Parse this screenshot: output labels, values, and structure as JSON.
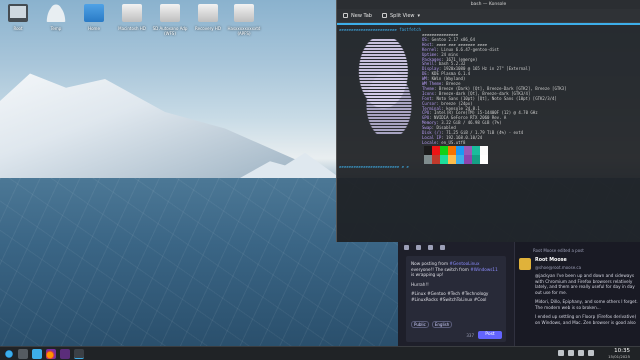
{
  "desktop_icons": [
    {
      "label": "Root",
      "icon": "monitor-icon"
    },
    {
      "label": "Temp",
      "icon": "user-folder-icon"
    },
    {
      "label": "Home",
      "icon": "home-folder-icon"
    },
    {
      "label": "Macintosh HD",
      "icon": "drive-icon"
    },
    {
      "label": "SD Autoxano Adp (WFS)",
      "icon": "drive-icon"
    },
    {
      "label": "Recovery HD",
      "icon": "drive-icon"
    },
    {
      "label": "Hasxxxxxxxxxtd (APFS)",
      "icon": "drive-icon"
    }
  ],
  "konsole": {
    "title": "bash — Konsole",
    "new_tab": "New Tab",
    "split_view": "Split View",
    "prompt_top": "▰▰▰▰▰▰▰▰▰▰▰▰▰▰▰▰▰▰▰▰▰▰▰▰ fastfetch",
    "prompt_bottom": "▰▰▰▰▰▰▰▰▰▰▰▰▰▰▰▰▰▰▰▰▰▰▰▰▰ ▰ ▰",
    "fastfetch": [
      {
        "k": "",
        "v": "▰▰▰▰▰▰▰▰▰▰▰▰▰▰▰"
      },
      {
        "k": "OS",
        "v": ": Gentoo 2.17 x86_64"
      },
      {
        "k": "Host",
        "v": ": ▰▰▰▰ ▰▰▰ ▰▰▰▰▰▰▰ ▰▰▰▰"
      },
      {
        "k": "Kernel",
        "v": ": Linux 6.6.47-gentoo-dist"
      },
      {
        "k": "Uptime",
        "v": ": 24 mins"
      },
      {
        "k": "Packages",
        "v": ": 1671 (emerge)"
      },
      {
        "k": "Shell",
        "v": ": bash 5.2.32"
      },
      {
        "k": "Display",
        "v": ": 1920x1080 @ 165 Hz in 27\" [External]"
      },
      {
        "k": "DE",
        "v": ": KDE Plasma 6.1.4"
      },
      {
        "k": "WM",
        "v": ": KWin (Wayland)"
      },
      {
        "k": "WM Theme",
        "v": ": Breeze"
      },
      {
        "k": "Theme",
        "v": ": Breeze (Dark) [Qt], Breeze-Dark [GTK2], Breeze [GTK3]"
      },
      {
        "k": "Icons",
        "v": ": Breeze-dark [Qt], Breeze-dark [GTK3/4]"
      },
      {
        "k": "Font",
        "v": ": Noto Sans (10pt) [Qt], Noto Sans (10pt) [GTK2/3/4]"
      },
      {
        "k": "Cursor",
        "v": ": breeze (24px)"
      },
      {
        "k": "Terminal",
        "v": ": konsole 24.8.1"
      },
      {
        "k": "CPU",
        "v": ": Intel(R) Core(TM) i5-14400F (12) @ 4.70 GHz"
      },
      {
        "k": "GPU",
        "v": ": NVIDIA GeForce RTX 2060 Rev. A"
      },
      {
        "k": "Memory",
        "v": ": 3.22 GiB / 46.98 GiB (7%)"
      },
      {
        "k": "Swap",
        "v": ": Disabled"
      },
      {
        "k": "Disk (/)",
        "v": ": 71.25 GiB / 1.79 TiB (4%) - ext4"
      },
      {
        "k": "Local IP",
        "v": ": 192.168.0.10/24"
      },
      {
        "k": "Locale",
        "v": ": en_US.utf8"
      }
    ],
    "palette": [
      "#1c1c1c",
      "#ed1515",
      "#11d116",
      "#f67400",
      "#1d99f3",
      "#9b59b6",
      "#1abc9c",
      "#fcfcfc",
      "#7f8c8d",
      "#c0392b",
      "#1cdc9a",
      "#fdbc4b",
      "#3daee9",
      "#8e44ad",
      "#16a085",
      "#ffffff"
    ]
  },
  "mastodon": {
    "compose_text_1": "Now posting from ",
    "compose_tag_1": "#GentooLinux",
    "compose_text_2": " everyone!! The switch from ",
    "compose_tag_2": "#Windows11",
    "compose_text_3": " is wrapping up!",
    "compose_text_4": "Hurrah!!",
    "compose_tags": "#Linux #Gentoo #Tech #Technology #LinuxRocks #SwitchToLinux #Cool",
    "visibility": "Public",
    "language": "English",
    "char_count": "337",
    "post_button": "Post",
    "boost_text": "Root Moose edited a post",
    "author_name": "Root Moose",
    "author_handle": "@shoe@root.moose.ca",
    "post_body_1": "@jackyan I've been up and down and sideways with Chromium and Firefox browsers relatively lately, and them are really useful for day in day out use for me.",
    "post_body_2": "Midori, Dillo, Epiphany, and some others I forget. The modern web is so broken...",
    "post_body_3": "I ended up settling on Floorp (Firefox derivative) on Windows, and Mac. Zen browser is good also"
  },
  "taskbar": {
    "time": "10:35",
    "date": "15/01/2025"
  }
}
